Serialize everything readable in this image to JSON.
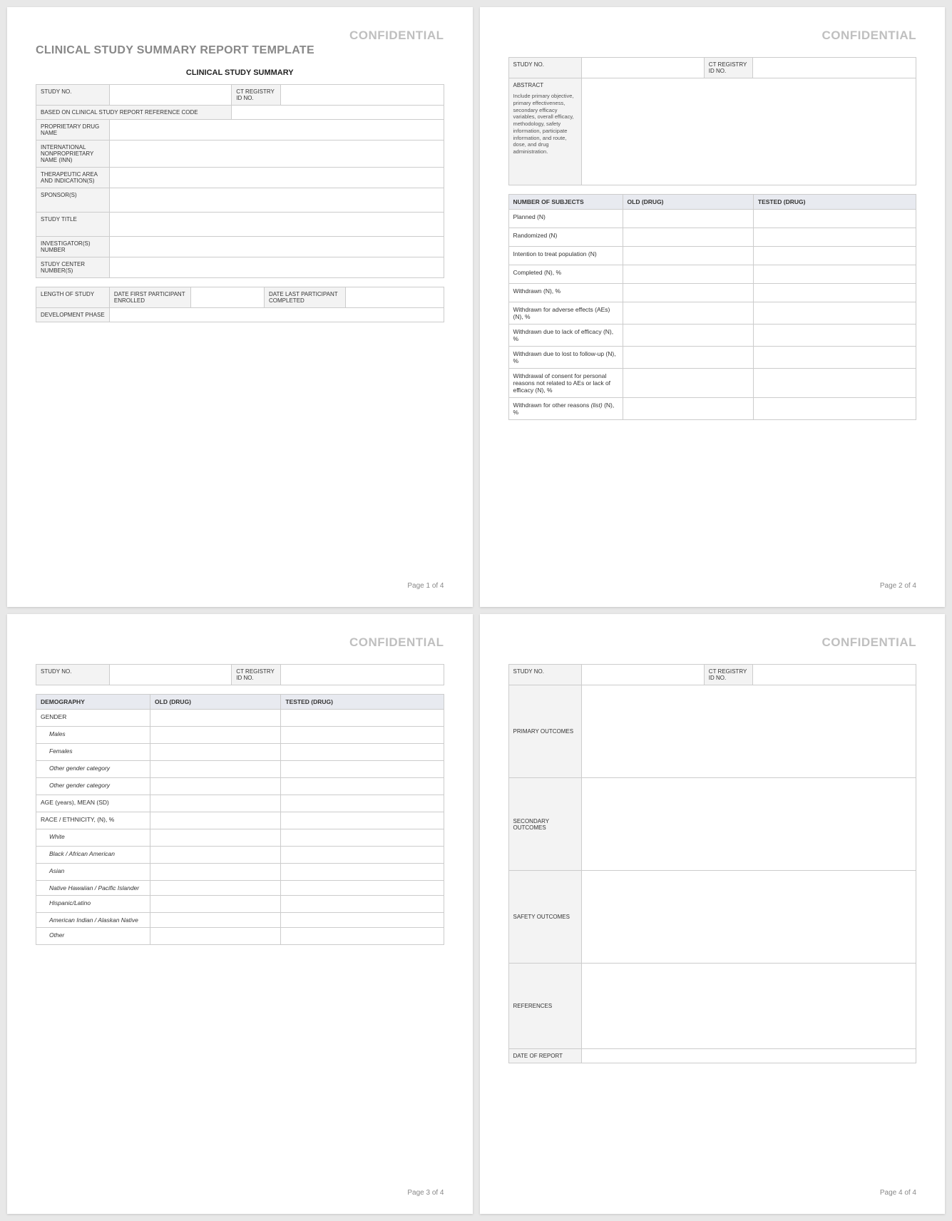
{
  "watermark": "CONFIDENTIAL",
  "title": "CLINICAL STUDY SUMMARY REPORT TEMPLATE",
  "subtitle": "CLINICAL STUDY SUMMARY",
  "footers": {
    "p1": "Page 1 of 4",
    "p2": "Page 2 of 4",
    "p3": "Page 3 of 4",
    "p4": "Page 4 of 4"
  },
  "common": {
    "study_no": "STUDY NO.",
    "ct_registry": "CT REGISTRY ID NO."
  },
  "page1": {
    "based_on": "BASED ON CLINICAL STUDY REPORT REFERENCE CODE",
    "proprietary": "PROPRIETARY DRUG NAME",
    "inn": "INTERNATIONAL NONPROPRIETARY NAME (INN)",
    "therapeutic": "THERAPEUTIC AREA AND INDICATION(S)",
    "sponsor": "SPONSOR(S)",
    "study_title": "STUDY TITLE",
    "investigators": "INVESTIGATOR(S) NUMBER",
    "center": "STUDY CENTER NUMBER(S)",
    "length": "LENGTH OF STUDY",
    "date_first": "DATE FIRST PARTICIPANT ENROLLED",
    "date_last": "DATE LAST PARTICIPANT COMPLETED",
    "dev_phase": "DEVELOPMENT PHASE"
  },
  "page2": {
    "abstract": "ABSTRACT",
    "abstract_note": "Include primary objective, primary effectiveness, secondary efficacy variables, overall efficacy, methodology, safety information, participate information, and route, dose, and drug administration.",
    "num_subjects": "NUMBER OF SUBJECTS",
    "old_drug": "OLD (DRUG)",
    "tested_drug": "TESTED (DRUG)",
    "rows": {
      "planned": "Planned (N)",
      "randomized": "Randomized (N)",
      "itt": "Intention to treat population (N)",
      "completed": "Completed (N), %",
      "withdrawn": "Withdrawn (N), %",
      "wd_ae": "Withdrawn for adverse effects (AEs) (N), %",
      "wd_eff": "Withdrawn due to lack of efficacy (N), %",
      "wd_lost": "Withdrawn due to lost to follow-up (N), %",
      "wd_consent": "Withdrawal of consent for personal reasons not related to AEs or lack of efficacy (N), %",
      "wd_other_prefix": "Withdrawn for other reasons ",
      "wd_other_italic": "(list)",
      "wd_other_suffix": " (N), %"
    }
  },
  "page3": {
    "demography": "DEMOGRAPHY",
    "old_drug": "OLD (DRUG)",
    "tested_drug": "TESTED (DRUG)",
    "gender": "GENDER",
    "males": "Males",
    "females": "Females",
    "other_gender": "Other gender category",
    "age": "AGE (years), MEAN (SD)",
    "race": "RACE / ETHNICITY, (N), %",
    "white": "White",
    "black": "Black / African American",
    "asian": "Asian",
    "native_h": "Native Hawaiian / Pacific Islander",
    "hispanic": "Hispanic/Latino",
    "native_a": "American Indian / Alaskan Native",
    "other": "Other"
  },
  "page4": {
    "primary": "PRIMARY OUTCOMES",
    "secondary": "SECONDARY OUTCOMES",
    "safety": "SAFETY OUTCOMES",
    "references": "REFERENCES",
    "date_report": "DATE OF REPORT"
  }
}
